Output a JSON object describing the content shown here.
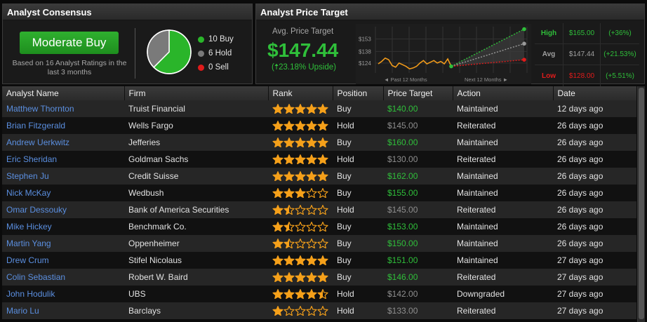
{
  "consensus": {
    "title": "Analyst Consensus",
    "rating": "Moderate Buy",
    "based_on": "Based on 16 Analyst Ratings in the last 3 months",
    "legend": [
      {
        "label": "10 Buy",
        "count": 10,
        "color": "#2ab52a"
      },
      {
        "label": "6 Hold",
        "count": 6,
        "color": "#7a7a7a"
      },
      {
        "label": "0 Sell",
        "count": 0,
        "color": "#e01b1b"
      }
    ]
  },
  "price_target": {
    "title": "Analyst Price Target",
    "avg_label": "Avg. Price Target",
    "avg_price": "$147.44",
    "upside": "(🠅23.18% Upside)",
    "chart": {
      "y_ticks": [
        "$153",
        "$138",
        "$124"
      ],
      "past_label": "◄ Past 12 Months",
      "next_label": "Next 12 Months ►",
      "history": [
        123,
        126,
        130,
        128,
        121,
        119,
        124,
        122,
        120,
        117,
        118,
        120,
        124,
        127,
        123,
        125,
        127,
        124,
        126,
        123,
        129,
        120
      ],
      "current": 120,
      "high": 165,
      "avg": 147.44,
      "low": 128,
      "y_min": 112,
      "y_max": 168
    },
    "rows": [
      {
        "label": "High",
        "value": "$165.00",
        "pct": "(+36%)",
        "color": "#2fbf3a"
      },
      {
        "label": "Avg",
        "value": "$147.44",
        "pct": "(+21.53%)",
        "color": "#a0a0a0"
      },
      {
        "label": "Low",
        "value": "$128.00",
        "pct": "(+5.51%)",
        "color": "#e01b1b"
      }
    ]
  },
  "table": {
    "headers": [
      "Analyst Name",
      "Firm",
      "Rank",
      "Position",
      "Price Target",
      "Action",
      "Date"
    ],
    "rows": [
      {
        "name": "Matthew Thornton",
        "firm": "Truist Financial",
        "rank": 5,
        "position": "Buy",
        "target": "$140.00",
        "target_color": "green",
        "action": "Maintained",
        "date": "12 days ago"
      },
      {
        "name": "Brian Fitzgerald",
        "firm": "Wells Fargo",
        "rank": 5,
        "position": "Hold",
        "target": "$145.00",
        "target_color": "gray",
        "action": "Reiterated",
        "date": "26 days ago"
      },
      {
        "name": "Andrew Uerkwitz",
        "firm": "Jefferies",
        "rank": 5,
        "position": "Buy",
        "target": "$160.00",
        "target_color": "green",
        "action": "Maintained",
        "date": "26 days ago"
      },
      {
        "name": "Eric Sheridan",
        "firm": "Goldman Sachs",
        "rank": 5,
        "position": "Hold",
        "target": "$130.00",
        "target_color": "gray",
        "action": "Reiterated",
        "date": "26 days ago"
      },
      {
        "name": "Stephen Ju",
        "firm": "Credit Suisse",
        "rank": 5,
        "position": "Buy",
        "target": "$162.00",
        "target_color": "green",
        "action": "Maintained",
        "date": "26 days ago"
      },
      {
        "name": "Nick McKay",
        "firm": "Wedbush",
        "rank": 3,
        "position": "Buy",
        "target": "$155.00",
        "target_color": "green",
        "action": "Maintained",
        "date": "26 days ago"
      },
      {
        "name": "Omar Dessouky",
        "firm": "Bank of America Securities",
        "rank": 1.5,
        "position": "Hold",
        "target": "$145.00",
        "target_color": "gray",
        "action": "Reiterated",
        "date": "26 days ago"
      },
      {
        "name": "Mike Hickey",
        "firm": "Benchmark Co.",
        "rank": 1.5,
        "position": "Buy",
        "target": "$153.00",
        "target_color": "green",
        "action": "Maintained",
        "date": "26 days ago"
      },
      {
        "name": "Martin Yang",
        "firm": "Oppenheimer",
        "rank": 1.5,
        "position": "Buy",
        "target": "$150.00",
        "target_color": "green",
        "action": "Maintained",
        "date": "26 days ago"
      },
      {
        "name": "Drew Crum",
        "firm": "Stifel Nicolaus",
        "rank": 5,
        "position": "Buy",
        "target": "$151.00",
        "target_color": "green",
        "action": "Maintained",
        "date": "27 days ago"
      },
      {
        "name": "Colin Sebastian",
        "firm": "Robert W. Baird",
        "rank": 5,
        "position": "Buy",
        "target": "$146.00",
        "target_color": "green",
        "action": "Reiterated",
        "date": "27 days ago"
      },
      {
        "name": "John Hodulik",
        "firm": "UBS",
        "rank": 4.5,
        "position": "Hold",
        "target": "$142.00",
        "target_color": "gray",
        "action": "Downgraded",
        "date": "27 days ago"
      },
      {
        "name": "Mario Lu",
        "firm": "Barclays",
        "rank": 1,
        "position": "Hold",
        "target": "$133.00",
        "target_color": "gray",
        "action": "Reiterated",
        "date": "27 days ago"
      }
    ]
  },
  "colors": {
    "star": "#f5a01a",
    "star_empty": "#f5a01a",
    "accent_green": "#2fbf3a"
  }
}
